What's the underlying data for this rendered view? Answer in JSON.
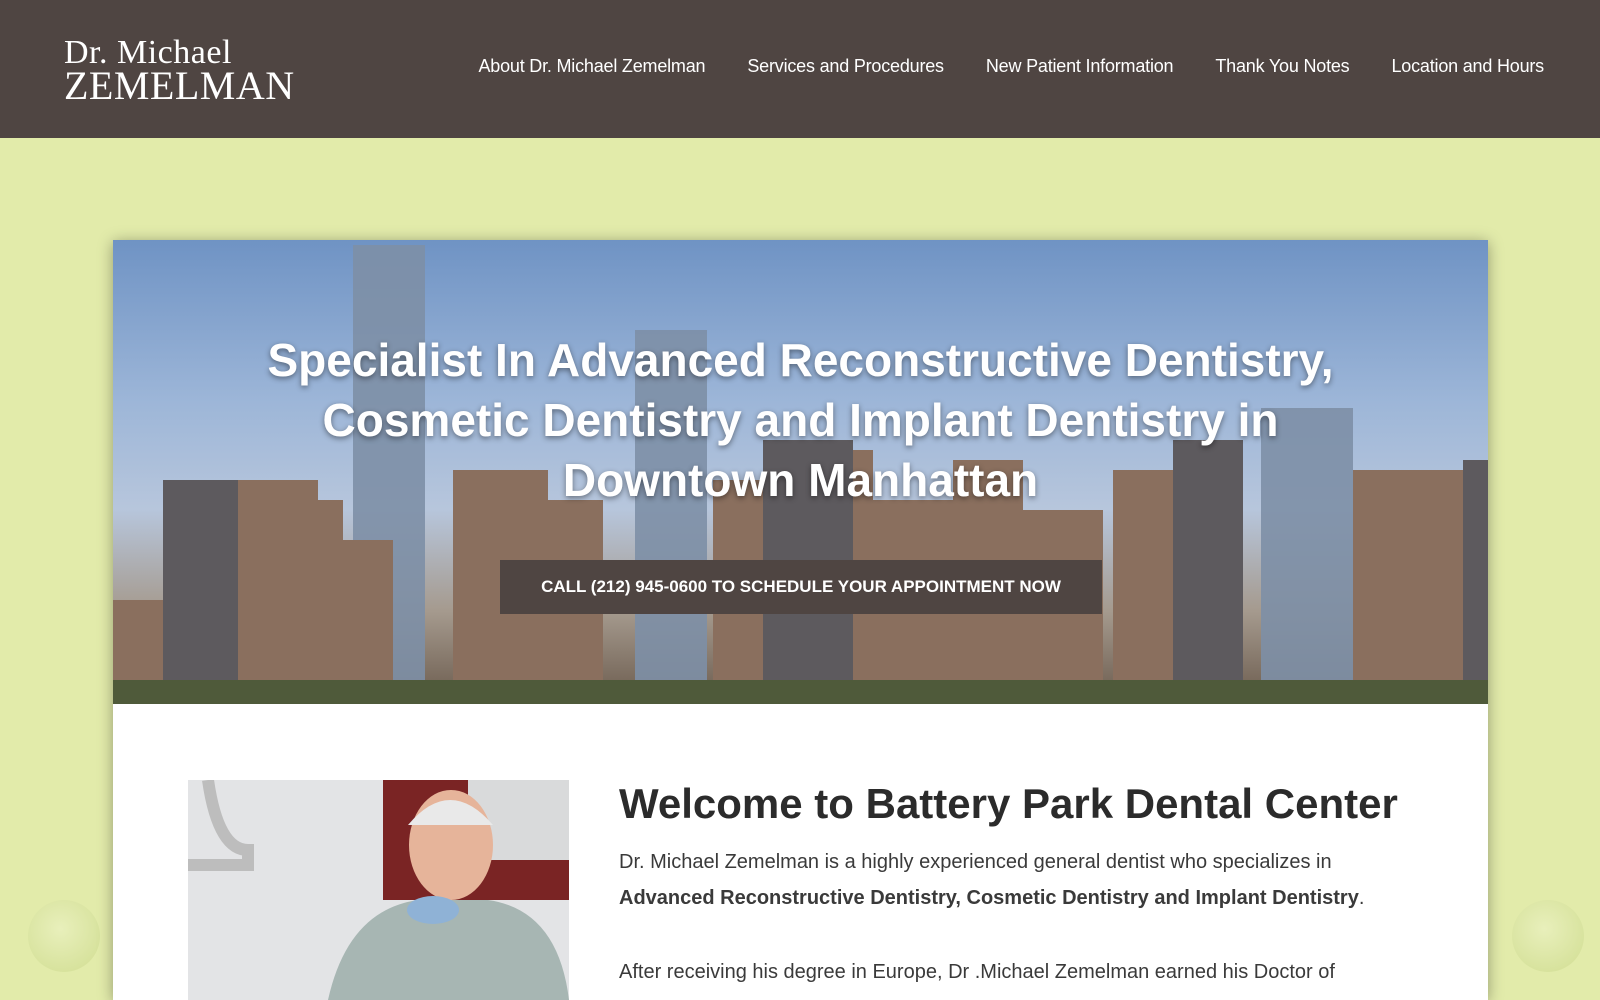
{
  "header": {
    "logo_line1": "Dr. Michael",
    "logo_line2": "ZEMELMAN",
    "nav": [
      {
        "label": "About Dr. Michael Zemelman"
      },
      {
        "label": "Services and Procedures"
      },
      {
        "label": "New Patient Information"
      },
      {
        "label": "Thank You Notes"
      },
      {
        "label": "Location and Hours"
      }
    ]
  },
  "hero": {
    "title": "Specialist In Advanced Reconstructive Dentistry, Cosmetic Dentistry and Implant Dentistry in Downtown Manhattan",
    "cta": "CALL (212) 945-0600 TO SCHEDULE YOUR APPOINTMENT NOW"
  },
  "main": {
    "heading": "Welcome to Battery Park Dental Center",
    "intro": "Dr. Michael Zemelman is a highly experienced general dentist who specializes in",
    "intro_bold": "Advanced Reconstructive Dentistry, Cosmetic Dentistry and Implant Dentistry",
    "intro_end": ".",
    "p2": "After receiving his degree in Europe, Dr .Michael Zemelman earned his Doctor of"
  },
  "colors": {
    "header_bg": "#4f4542",
    "page_bg": "#e2ebaa",
    "cta_bg": "#4f4542"
  }
}
